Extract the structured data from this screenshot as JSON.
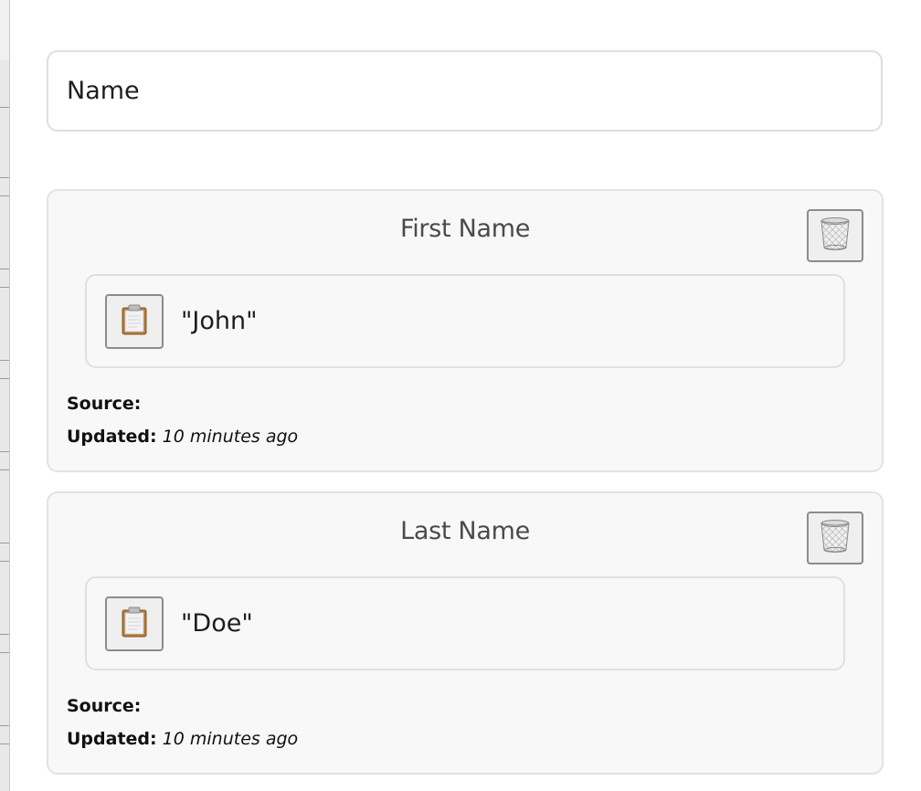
{
  "name_field": {
    "label": "Name"
  },
  "fields": [
    {
      "title": "First Name",
      "value": "\"John\"",
      "source_label": "Source:",
      "source_value": "",
      "updated_label": "Updated:",
      "updated_value": "10 minutes ago"
    },
    {
      "title": "Last Name",
      "value": "\"Doe\"",
      "source_label": "Source:",
      "source_value": "",
      "updated_label": "Updated:",
      "updated_value": "10 minutes ago"
    }
  ],
  "icons": {
    "delete": "trash-icon",
    "copy": "clipboard-icon"
  },
  "colors": {
    "card_background": "#f8f8f8",
    "card_border": "#e2e2e2",
    "title_text": "#4a4a4a",
    "button_border": "#8c8c8c"
  }
}
